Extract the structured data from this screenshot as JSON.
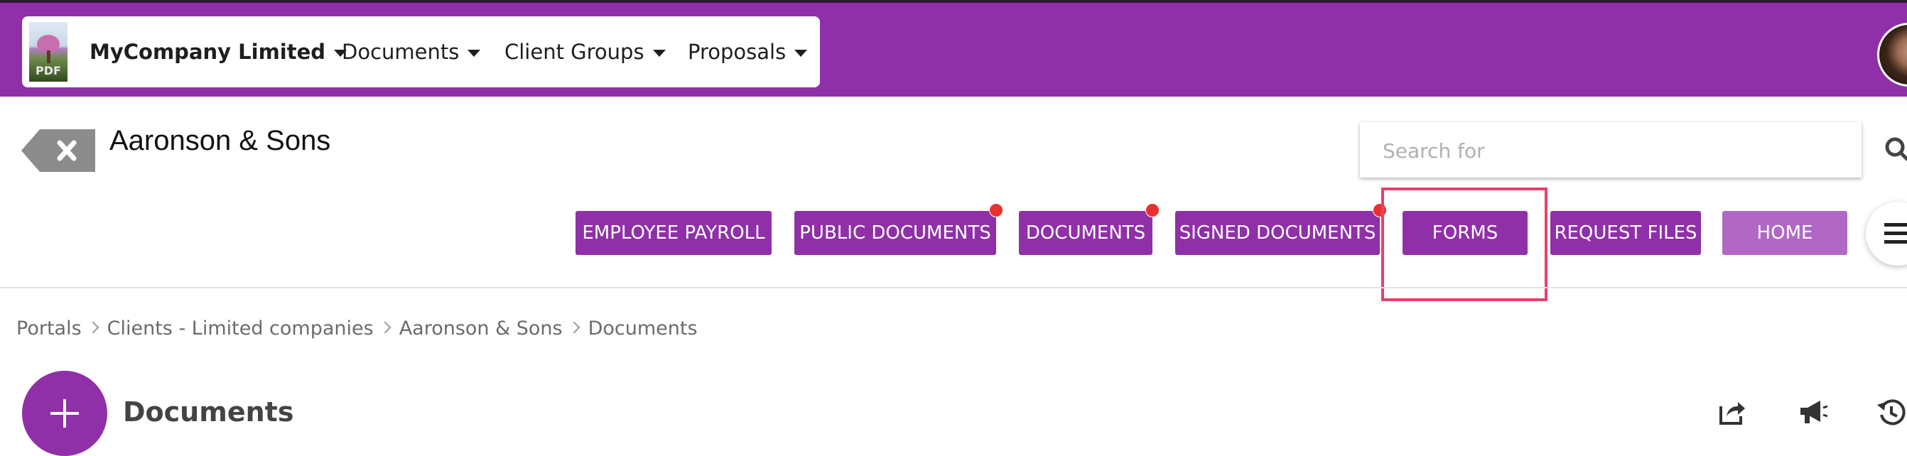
{
  "header": {
    "company": "MyCompany Limited",
    "logo_text": "PDF",
    "nav": [
      {
        "label": "Documents"
      },
      {
        "label": "Client Groups"
      },
      {
        "label": "Proposals"
      }
    ]
  },
  "page": {
    "title": "Aaronson & Sons"
  },
  "search": {
    "placeholder": "Search for",
    "value": ""
  },
  "tabs": [
    {
      "label": "EMPLOYEE PAYROLL",
      "notification": false
    },
    {
      "label": "PUBLIC DOCUMENTS",
      "notification": true
    },
    {
      "label": "DOCUMENTS",
      "notification": true
    },
    {
      "label": "SIGNED DOCUMENTS",
      "notification": true
    },
    {
      "label": "FORMS",
      "notification": false,
      "highlighted": true
    },
    {
      "label": "REQUEST FILES",
      "notification": false
    },
    {
      "label": "HOME",
      "notification": false,
      "active": true
    }
  ],
  "breadcrumb": [
    "Portals",
    "Clients - Limited companies",
    "Aaronson & Sons",
    "Documents"
  ],
  "section": {
    "title": "Documents"
  },
  "colors": {
    "brand": "#9030a8",
    "brand_light": "#b068c4",
    "notification": "#e8312f",
    "highlight": "#e8406c"
  },
  "icons": [
    "back-tag-icon",
    "search-icon",
    "menu-icon",
    "plus-icon",
    "share-icon",
    "megaphone-icon",
    "history-icon"
  ]
}
